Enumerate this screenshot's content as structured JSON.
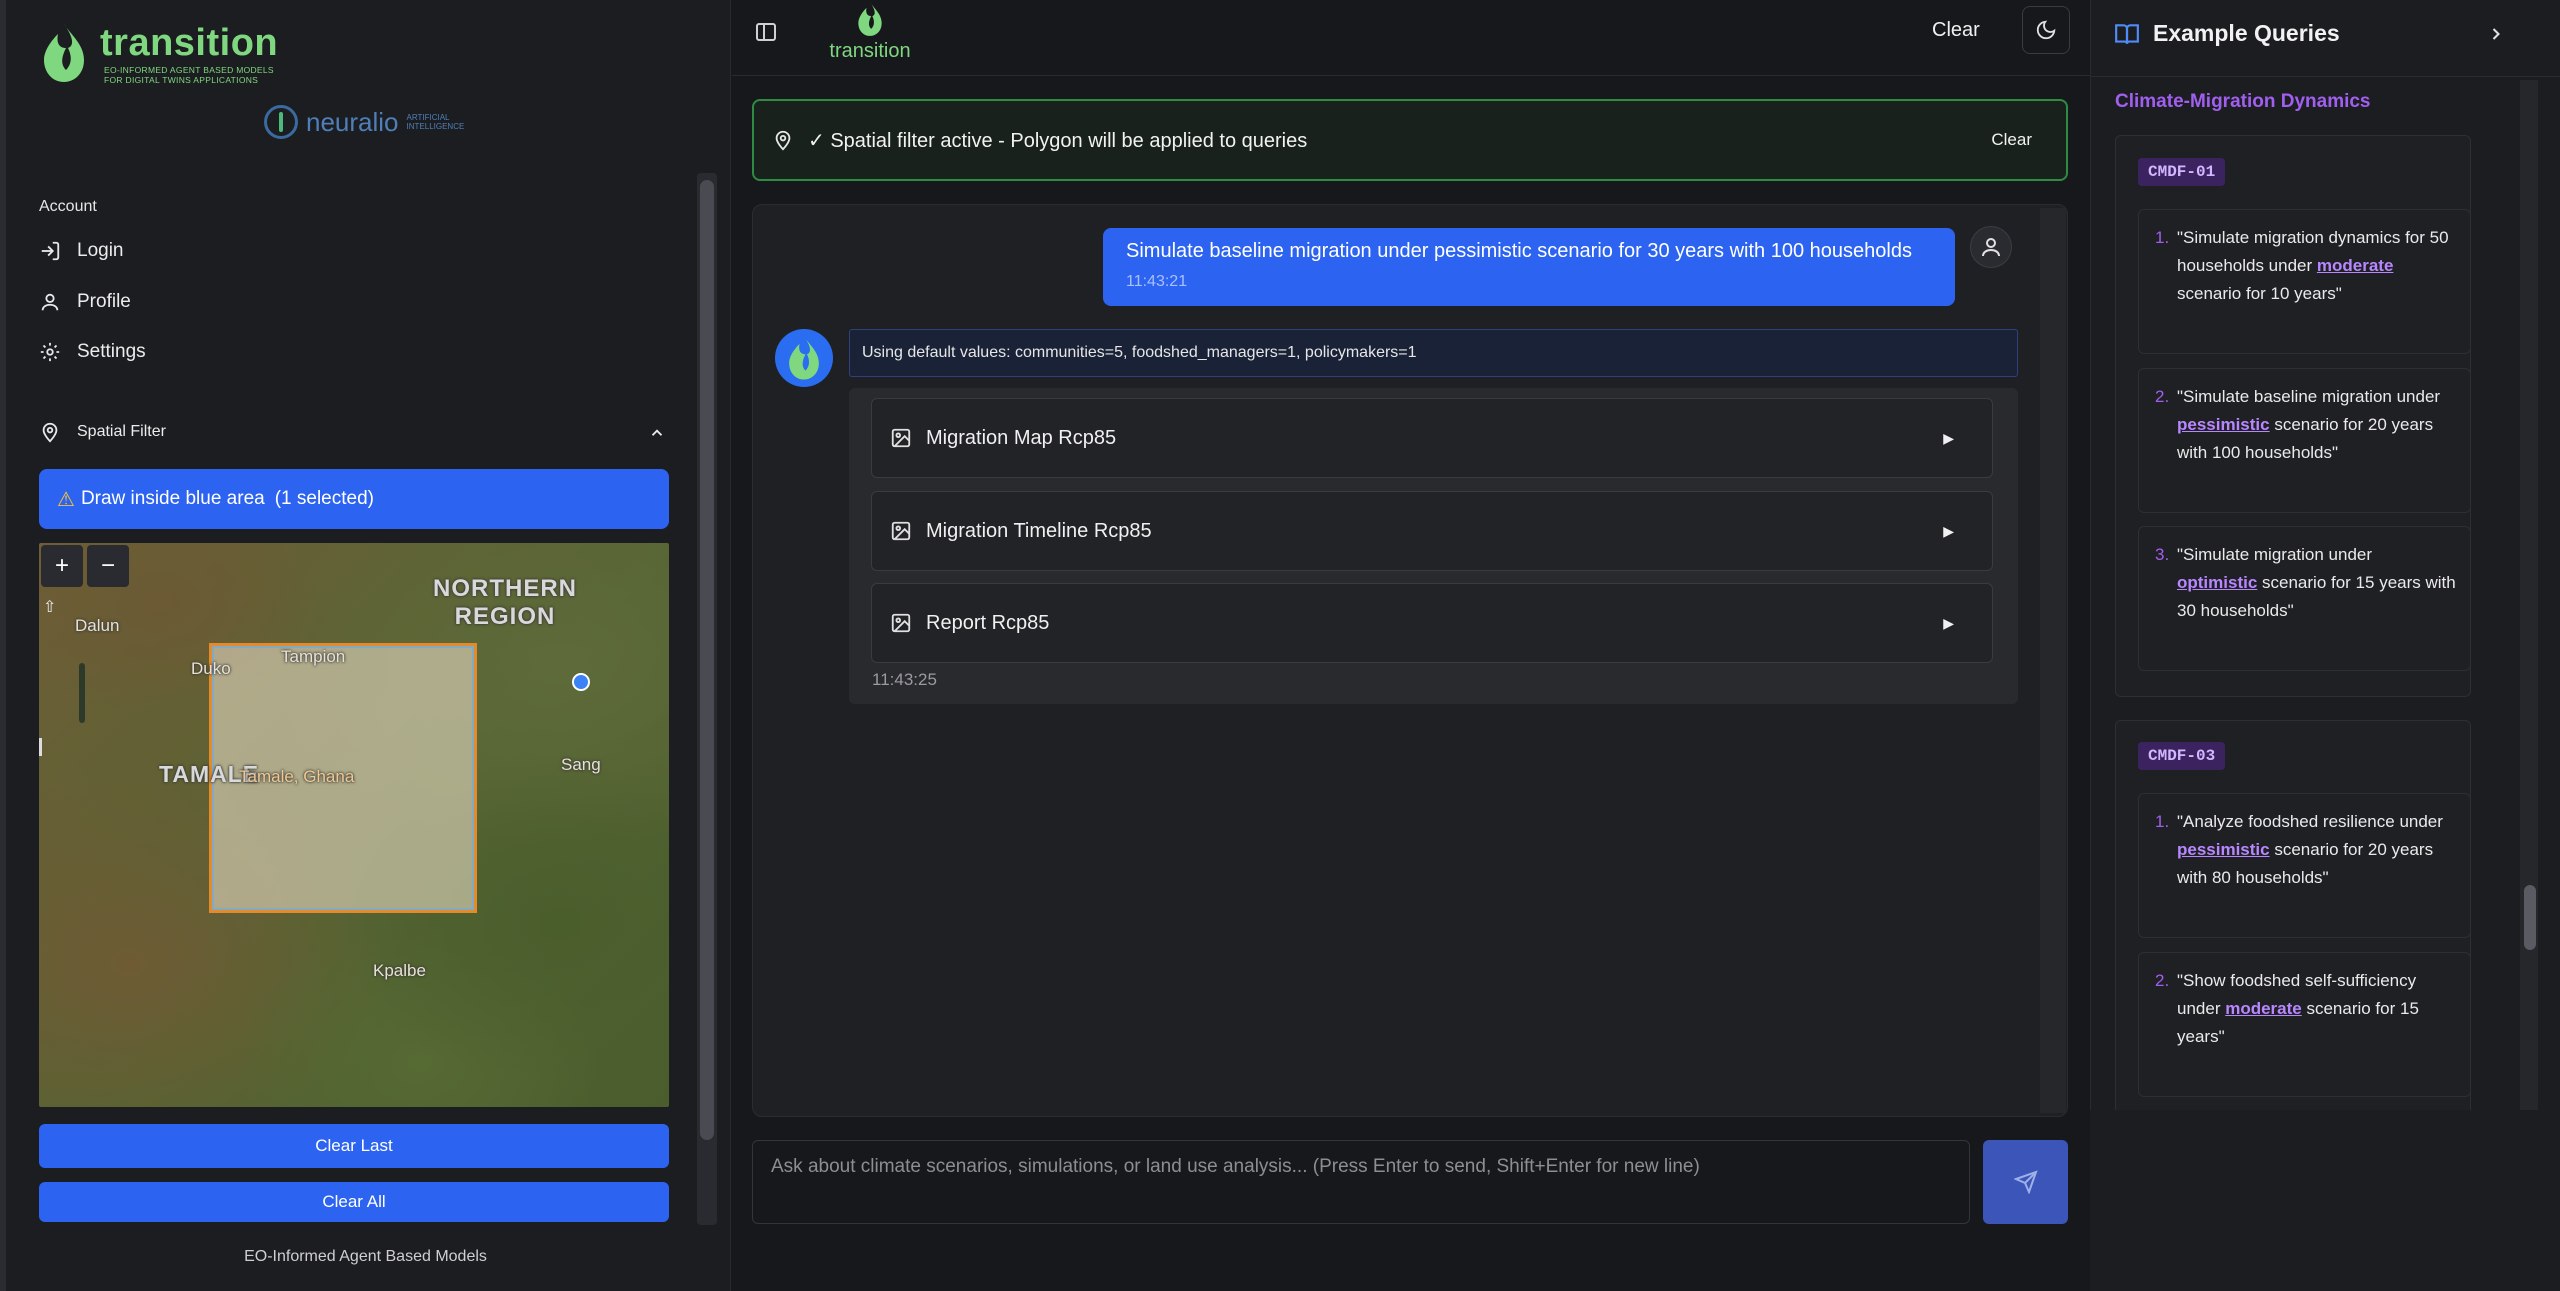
{
  "brand": {
    "name": "transition",
    "subtitle_line1": "EO-INFORMED AGENT BASED MODELS",
    "subtitle_line2": "FOR DIGITAL TWINS APPLICATIONS",
    "partner": "neuralio",
    "partner_sub_line1": "ARTIFICIAL",
    "partner_sub_line2": "INTELLIGENCE"
  },
  "sidebar": {
    "account_title": "Account",
    "items": [
      {
        "label": "Login",
        "icon": "login-icon"
      },
      {
        "label": "Profile",
        "icon": "user-icon"
      },
      {
        "label": "Settings",
        "icon": "gear-icon"
      }
    ],
    "spatial_filter_title": "Spatial Filter",
    "warning": "Draw inside blue area",
    "warning_selected": "(1 selected)",
    "map": {
      "zoom_in": "+",
      "zoom_out": "−",
      "labels": {
        "northern_region": "NORTHERN",
        "northern_region2": "REGION",
        "dalun": "Dalun",
        "tampion": "Tampion",
        "duko": "Duko",
        "tamale": "TAMALE",
        "tamale_ghana": "Tamale, Ghana",
        "sang": "Sang",
        "kpalbe": "Kpalbe"
      }
    },
    "clear_last": "Clear Last",
    "clear_all": "Clear All",
    "footer": "EO-Informed Agent Based Models"
  },
  "topbar": {
    "logo_text": "transition",
    "clear": "Clear"
  },
  "filter_banner": {
    "text": "✓ Spatial filter active - Polygon will be applied to queries",
    "clear": "Clear"
  },
  "chat": {
    "user_message": "Simulate baseline migration under pessimistic scenario for 30 years with 100 households",
    "user_time": "11:43:21",
    "bot_info": "Using default values: communities=5, foodshed_managers=1, policymakers=1",
    "results": [
      {
        "label": "Migration Map Rcp85"
      },
      {
        "label": "Migration Timeline Rcp85"
      },
      {
        "label": "Report Rcp85"
      }
    ],
    "bot_time": "11:43:25"
  },
  "composer": {
    "placeholder": "Ask about climate scenarios, simulations, or land use analysis... (Press Enter to send, Shift+Enter for new line)"
  },
  "right_panel": {
    "title": "Example Queries",
    "category": "Climate-Migration Dynamics",
    "groups": [
      {
        "badge": "CMDF-01",
        "queries": [
          {
            "num": "1.",
            "pre": "\"Simulate migration dynamics for 50 households under ",
            "hl": "moderate",
            "post": " scenario for 10 years\""
          },
          {
            "num": "2.",
            "pre": "\"Simulate baseline migration under ",
            "hl": "pessimistic",
            "post": " scenario for 20 years with 100 households\""
          },
          {
            "num": "3.",
            "pre": "\"Simulate migration under ",
            "hl": "optimistic",
            "post": " scenario for 15 years with 30 households\""
          }
        ]
      },
      {
        "badge": "CMDF-03",
        "queries": [
          {
            "num": "1.",
            "pre": "\"Analyze foodshed resilience under ",
            "hl": "pessimistic",
            "post": " scenario for 20 years with 80 households\""
          },
          {
            "num": "2.",
            "pre": "\"Show foodshed self-sufficiency under ",
            "hl": "moderate",
            "post": " scenario for 15 years\""
          }
        ]
      }
    ]
  },
  "colors": {
    "accent_blue": "#2c63f0",
    "brand_green": "#7fd87f",
    "purple": "#a15ff0"
  }
}
